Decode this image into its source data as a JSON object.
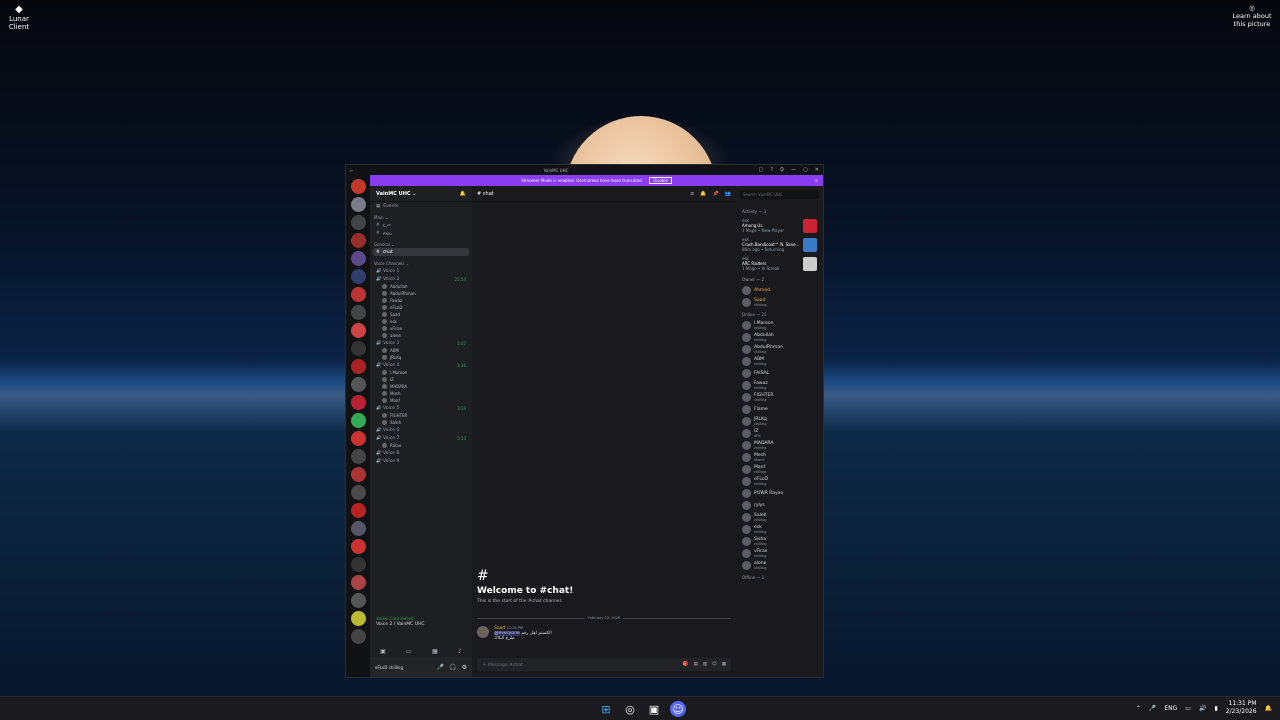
{
  "desktop": {
    "shortcut_label": "Lunar Client",
    "learn_label": "Learn about this picture"
  },
  "window": {
    "title": "VainMC UHC",
    "controls": [
      "□",
      "?",
      "⛭",
      "—",
      "▢",
      "✕"
    ]
  },
  "banner": {
    "text": "Streamer Mode is enabled. Usernames have been truncated.",
    "button": "Disable",
    "close": "✕"
  },
  "server": {
    "name": "VainMC UHC ⌄",
    "events_label": "Events",
    "category_main": "Main ⌄",
    "channels_main": [
      "خرع",
      "رووم"
    ],
    "category_general": "General ⌄",
    "selected_channel": "chat",
    "category_voice": "Voice Channels ⌄",
    "voice_channels": [
      {
        "name": "Voice 1",
        "time": "",
        "users": []
      },
      {
        "name": "Voice 2",
        "time": "25:54",
        "users": [
          "Abdullah",
          "AbdulRhman",
          "Fawaz",
          "eFLoD",
          "Saad",
          "esk",
          "vFirax",
          "alone"
        ]
      },
      {
        "name": "Voice 3",
        "time": "3:47",
        "users": [
          "ABM",
          "JRLKq"
        ]
      },
      {
        "name": "Voice 4",
        "time": "3:36",
        "users": [
          "I.Maroon",
          "IZ",
          "MADARA",
          "Mesh",
          "Manf"
        ]
      },
      {
        "name": "Voice 5",
        "time": "3:33",
        "users": [
          "FIGHTER",
          "Saleh"
        ]
      },
      {
        "name": "Voice 6",
        "time": "",
        "users": []
      },
      {
        "name": "Voice 7",
        "time": "5:13",
        "users": [
          "Ralax"
        ]
      },
      {
        "name": "Voice 8",
        "time": "",
        "users": []
      },
      {
        "name": "Voice 9",
        "time": "",
        "users": []
      }
    ],
    "voice_status": "Voice Connected",
    "voice_sub": "Voice 2 / VainMC UHC",
    "user_name": "eFLoD",
    "user_status": "chilling"
  },
  "chat": {
    "channel": "chat",
    "welcome_title": "Welcome to #chat!",
    "welcome_sub": "This is the start of the #chat channel.",
    "date_divider": "February 23, 2026",
    "message_author": "Saad",
    "message_time": "11:14 PM",
    "message_mention": "@everyone",
    "message_text": "الكستم لفل رقم",
    "message_text2": "طرع البلاك",
    "composer_placeholder": "Message #chat"
  },
  "members": {
    "search_placeholder": "Search VainMC UHC",
    "activity_header": "Activity — 3",
    "activities": [
      {
        "user": "esk",
        "title": "Among Us",
        "sub": "1 Mage • New Player"
      },
      {
        "user": "esk",
        "title": "Crash Bandicoot™ N. Sane...",
        "sub": "96m ago • Returning"
      },
      {
        "user": "esk",
        "title": "ARC Raiders",
        "sub": "1 Mage • In Streak"
      }
    ],
    "owner_header": "Owner — 2",
    "owners": [
      {
        "name": "Ahmed",
        "status": "",
        "color": "#f0b232"
      },
      {
        "name": "Saad",
        "status": "chilling",
        "color": "#f0b232"
      }
    ],
    "online_header": "Online — 21",
    "online": [
      {
        "name": "I.Maroon",
        "status": "chilling"
      },
      {
        "name": "Abdullah",
        "status": "chilling"
      },
      {
        "name": "AbdulRhman",
        "status": "chilling"
      },
      {
        "name": "ABM",
        "status": "chilling"
      },
      {
        "name": "FAISAL",
        "status": ""
      },
      {
        "name": "Fawaz",
        "status": "chilling"
      },
      {
        "name": "FIGHTER",
        "status": "chilling"
      },
      {
        "name": "Flame",
        "status": ""
      },
      {
        "name": "JRLKq",
        "status": "chilling"
      },
      {
        "name": "IZ",
        "status": "AFK"
      },
      {
        "name": "MADARA",
        "status": "chilling"
      },
      {
        "name": "Mesh",
        "status": "shard"
      },
      {
        "name": "Manf",
        "status": "chilling"
      },
      {
        "name": "eFLoD",
        "status": "chilling"
      },
      {
        "name": "POWR Rayan",
        "status": ""
      },
      {
        "name": "rylys",
        "status": ""
      },
      {
        "name": "Saleh",
        "status": "chilling"
      },
      {
        "name": "esk",
        "status": "chilling"
      },
      {
        "name": "Sisha",
        "status": "chilling"
      },
      {
        "name": "vFirax",
        "status": "chilling"
      },
      {
        "name": "alone",
        "status": "chilling"
      }
    ],
    "offline_header": "Offline — 1"
  },
  "taskbar": {
    "tray_lang": "ENG",
    "time": "11:31 PM",
    "date": "2/23/2026"
  }
}
